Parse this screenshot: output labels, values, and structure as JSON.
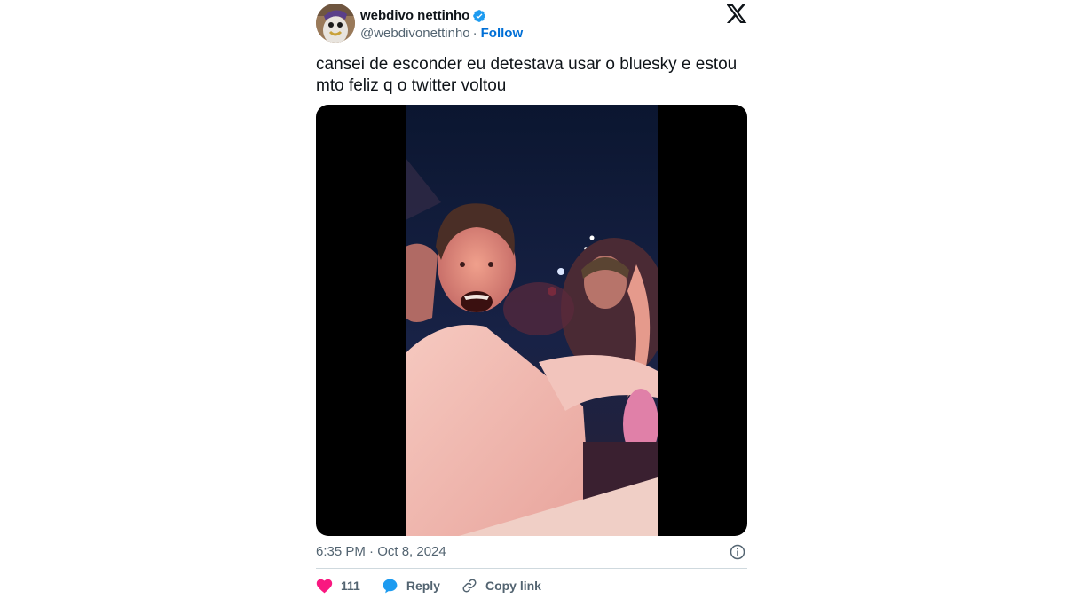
{
  "author": {
    "display_name": "webdivo nettinho",
    "handle": "@webdivonettinho",
    "separator": "·",
    "follow_label": "Follow",
    "verified": true
  },
  "tweet": {
    "text": "cansei de esconder eu detestava usar o bluesky e estou\nmto feliz q o twitter voltou",
    "timestamp": "6:35 PM · Oct 8, 2024"
  },
  "actions": {
    "likes_count": "111",
    "reply_label": "Reply",
    "copy_link_label": "Copy link"
  },
  "colors": {
    "link_blue": "#006fd6",
    "verified_blue": "#1d9bf0",
    "like_pink": "#f91880",
    "muted_text": "#536471",
    "text": "#0f1419",
    "divider": "#cfd9de"
  },
  "icons": {
    "brand": "x-logo-icon",
    "verified": "verified-badge-icon",
    "info": "info-icon",
    "like": "heart-icon",
    "reply": "speech-bubble-icon",
    "copy_link": "link-icon"
  }
}
